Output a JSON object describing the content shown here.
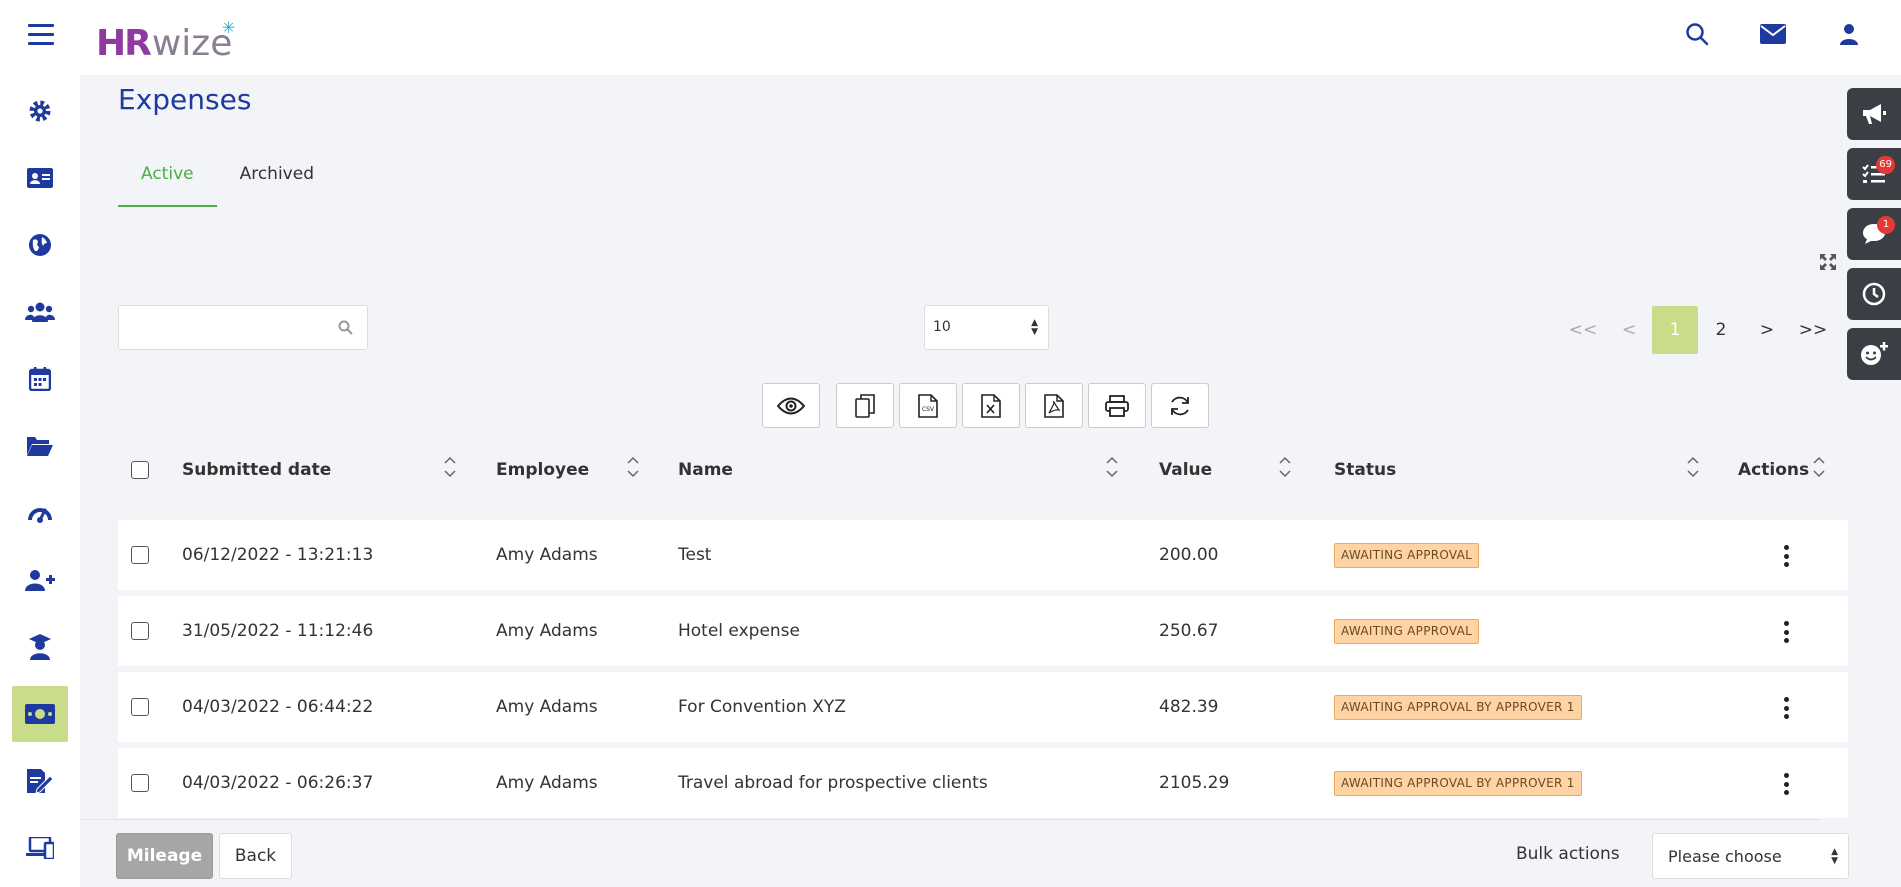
{
  "app": {
    "logo_hr": "HR",
    "logo_wize": "wize"
  },
  "page": {
    "title": "Expenses"
  },
  "tabs": [
    {
      "label": "Active",
      "active": true
    },
    {
      "label": "Archived",
      "active": false
    }
  ],
  "search": {
    "placeholder": ""
  },
  "per_page": {
    "value": "10"
  },
  "pagination": {
    "first": "<<",
    "prev": "<",
    "current": "1",
    "page2": "2",
    "next": ">",
    "last": ">>"
  },
  "toolbar_icons": [
    "eye-icon",
    "copy-icon",
    "csv-icon",
    "excel-icon",
    "pdf-icon",
    "print-icon",
    "refresh-icon"
  ],
  "table": {
    "columns": {
      "submitted": "Submitted date",
      "employee": "Employee",
      "name": "Name",
      "value": "Value",
      "status": "Status",
      "actions": "Actions"
    },
    "rows": [
      {
        "date": "06/12/2022 - 13:21:13",
        "employee": "Amy Adams",
        "name": "Test",
        "value": "200.00",
        "status": "AWAITING APPROVAL"
      },
      {
        "date": "31/05/2022 - 11:12:46",
        "employee": "Amy Adams",
        "name": "Hotel expense",
        "value": "250.67",
        "status": "AWAITING APPROVAL"
      },
      {
        "date": "04/03/2022 - 06:44:22",
        "employee": "Amy Adams",
        "name": "For Convention XYZ",
        "value": "482.39",
        "status": "AWAITING APPROVAL BY APPROVER 1"
      },
      {
        "date": "04/03/2022 - 06:26:37",
        "employee": "Amy Adams",
        "name": "Travel abroad for prospective clients",
        "value": "2105.29",
        "status": "AWAITING APPROVAL BY APPROVER 1"
      }
    ]
  },
  "footer": {
    "mileage": "Mileage",
    "back": "Back",
    "bulk_label": "Bulk actions",
    "bulk_select": "Please choose"
  },
  "right_panel": {
    "tasks_badge": "69",
    "chat_badge": "1"
  },
  "colors": {
    "brand_blue": "#1f3a9e",
    "active_green": "#4aaf46",
    "accent_lime": "#c8dc8a",
    "badge_orange": "#ffd3a4"
  }
}
